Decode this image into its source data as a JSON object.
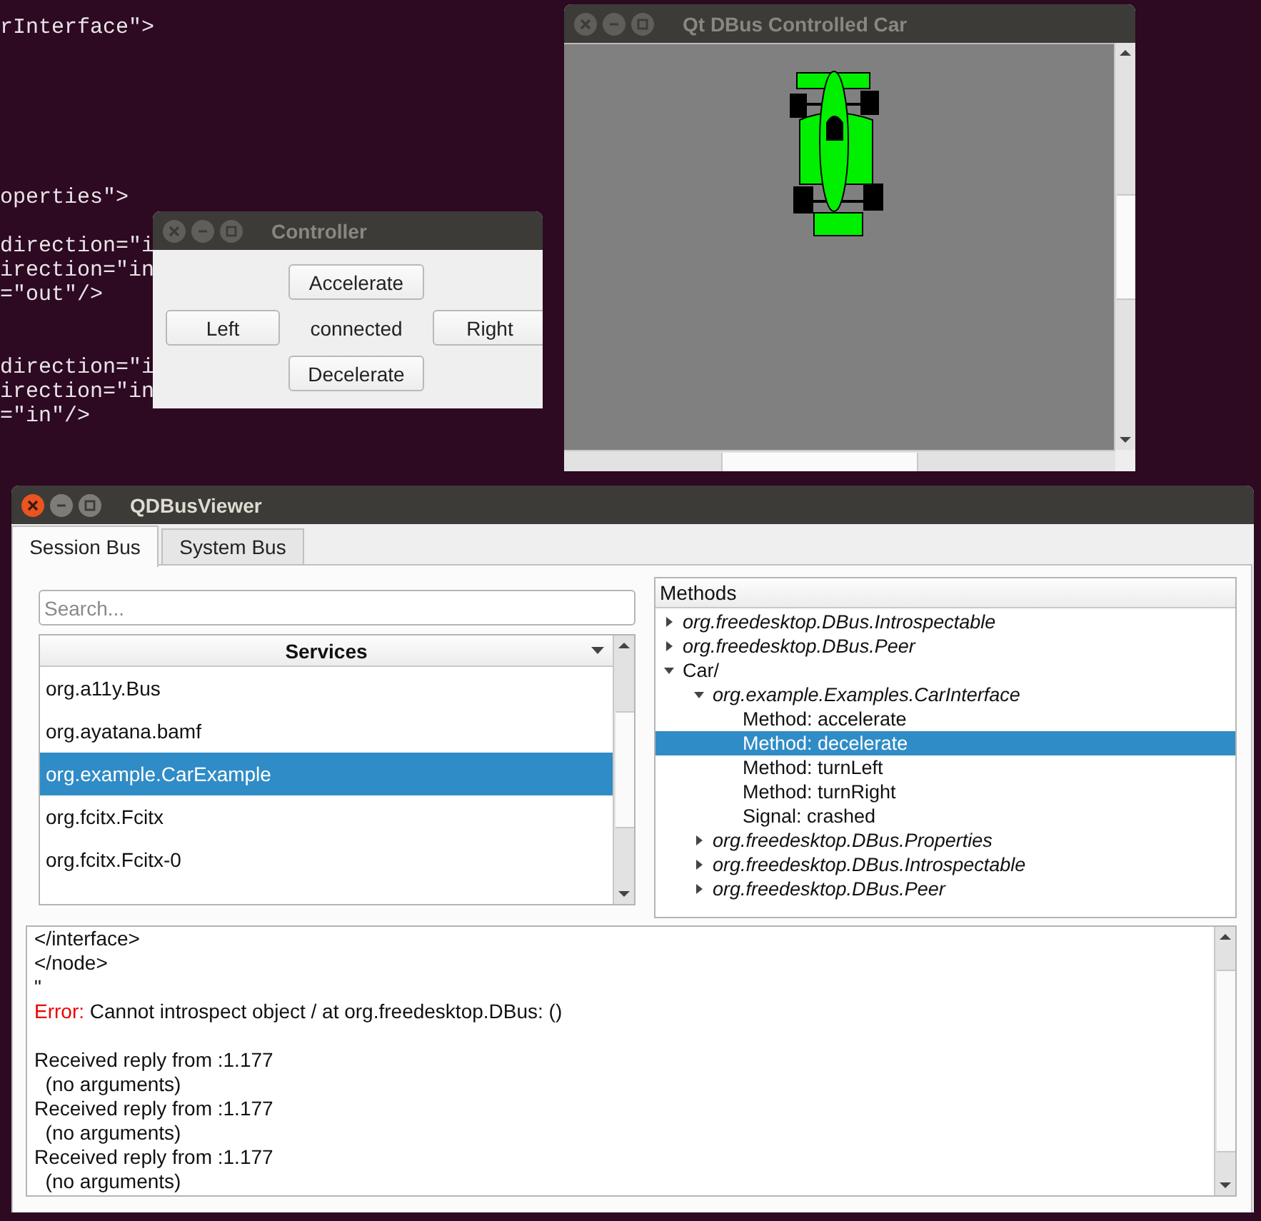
{
  "terminal": {
    "lines": [
      "rInterface\">",
      "operties\">",
      "direction=\"i",
      "irection=\"in",
      "=\"out\"/>",
      "direction=\"i",
      "irection=\"in",
      "=\"in\"/>"
    ]
  },
  "car_window": {
    "title": "Qt DBus Controlled Car",
    "active": false
  },
  "controller": {
    "title": "Controller",
    "active": false,
    "accelerate": "Accelerate",
    "left": "Left",
    "status": "connected",
    "right": "Right",
    "decelerate": "Decelerate"
  },
  "viewer": {
    "title": "QDBusViewer",
    "active": true,
    "tabs": [
      {
        "label": "Session Bus",
        "selected": true
      },
      {
        "label": "System Bus",
        "selected": false
      }
    ],
    "search": {
      "placeholder": "Search..."
    },
    "services": {
      "header": "Services",
      "items": [
        {
          "label": "org.a11y.Bus",
          "selected": false
        },
        {
          "label": "org.ayatana.bamf",
          "selected": false
        },
        {
          "label": "org.example.CarExample",
          "selected": true
        },
        {
          "label": "org.fcitx.Fcitx",
          "selected": false
        },
        {
          "label": "org.fcitx.Fcitx-0",
          "selected": false
        }
      ]
    },
    "methods": {
      "header": "Methods",
      "tree": [
        {
          "label": "org.freedesktop.DBus.Introspectable",
          "kind": "interface",
          "expanded": false,
          "selected": false
        },
        {
          "label": "org.freedesktop.DBus.Peer",
          "kind": "interface",
          "expanded": false,
          "selected": false
        },
        {
          "label": "Car/",
          "kind": "path",
          "expanded": true,
          "selected": false,
          "children": [
            {
              "label": "org.example.Examples.CarInterface",
              "kind": "interface",
              "expanded": true,
              "selected": false,
              "children": [
                {
                  "label": "Method: accelerate",
                  "kind": "member",
                  "selected": false
                },
                {
                  "label": "Method: decelerate",
                  "kind": "member",
                  "selected": true
                },
                {
                  "label": "Method: turnLeft",
                  "kind": "member",
                  "selected": false
                },
                {
                  "label": "Method: turnRight",
                  "kind": "member",
                  "selected": false
                },
                {
                  "label": "Signal: crashed",
                  "kind": "member",
                  "selected": false
                }
              ]
            },
            {
              "label": "org.freedesktop.DBus.Properties",
              "kind": "interface",
              "expanded": false,
              "selected": false
            },
            {
              "label": "org.freedesktop.DBus.Introspectable",
              "kind": "interface",
              "expanded": false,
              "selected": false
            },
            {
              "label": "org.freedesktop.DBus.Peer",
              "kind": "interface",
              "expanded": false,
              "selected": false
            }
          ]
        }
      ]
    },
    "log": {
      "blocks": [
        [
          {
            "kind": "text",
            "text": "</interface>"
          },
          {
            "kind": "text",
            "text": "</node>"
          },
          {
            "kind": "text",
            "text": "\""
          },
          {
            "kind": "error",
            "label": "Error:",
            "text": "Cannot introspect object / at org.freedesktop.DBus: ()"
          }
        ],
        [
          {
            "kind": "text",
            "text": "Received reply from :1.177"
          },
          {
            "kind": "text",
            "text": "  (no arguments)"
          },
          {
            "kind": "text",
            "text": "Received reply from :1.177"
          },
          {
            "kind": "text",
            "text": "  (no arguments)"
          },
          {
            "kind": "text",
            "text": "Received reply from :1.177"
          },
          {
            "kind": "text",
            "text": "  (no arguments)"
          }
        ]
      ]
    }
  }
}
